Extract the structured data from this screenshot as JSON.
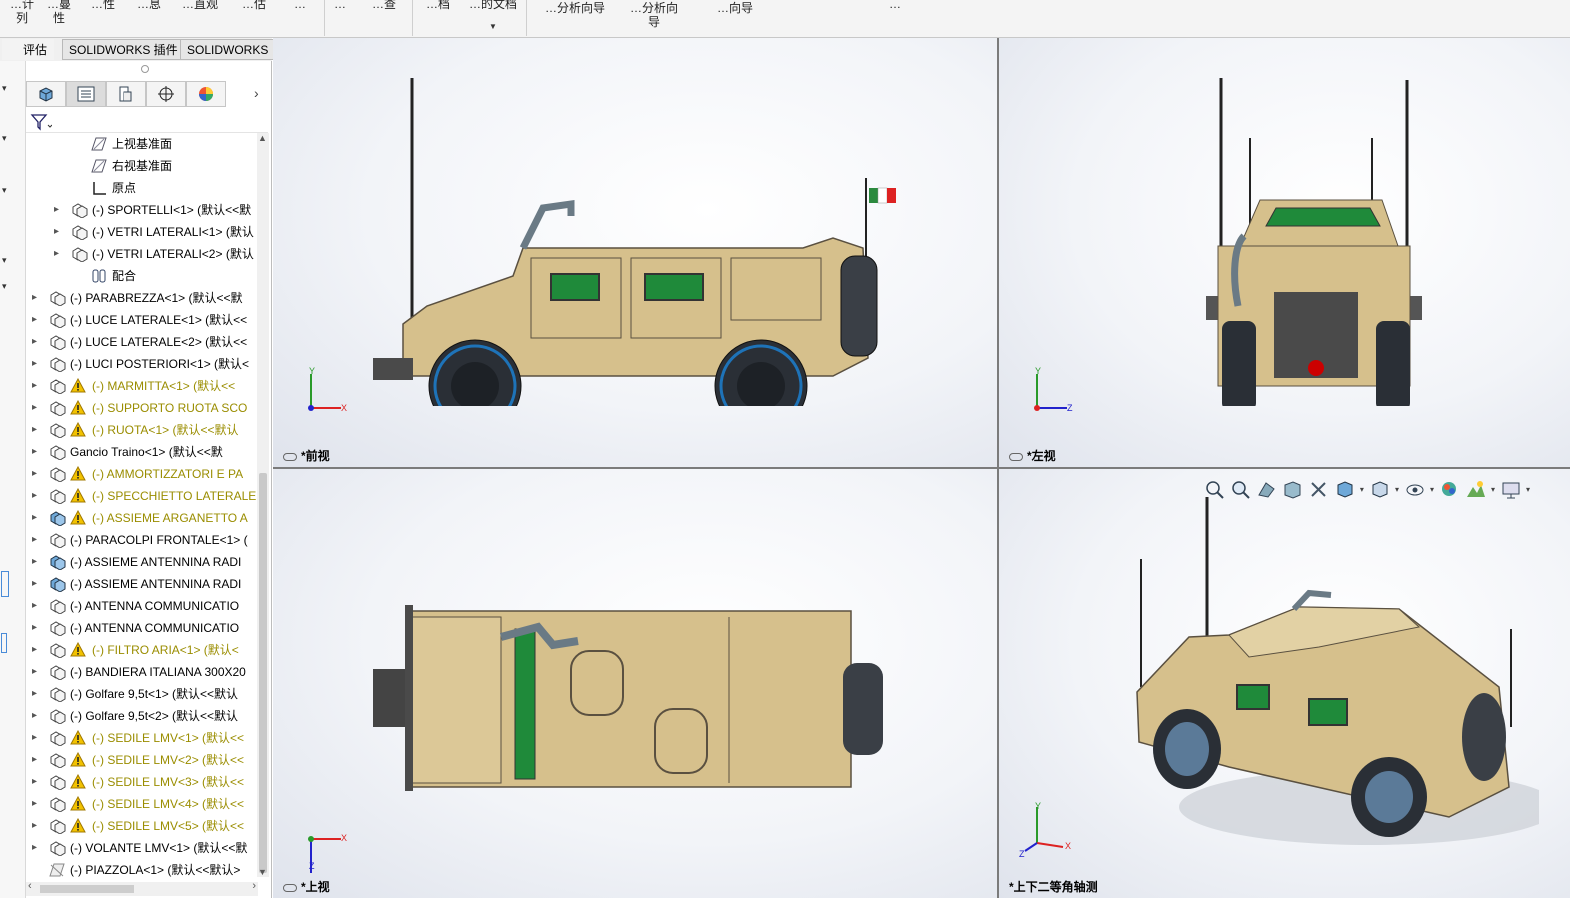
{
  "ribbon": {
    "items": [
      "…计\n列",
      "…蔓\n性",
      "…性",
      "…息",
      "…直观",
      "…估",
      "…",
      "…查",
      "…档",
      "…的文档",
      "…分析向导",
      "…分析向\n导",
      "…向导",
      "…",
      "…"
    ]
  },
  "tabs": {
    "evaluate": "评估",
    "addins": "SOLIDWORKS 插件",
    "mbd": "SOLIDWORKS MBD"
  },
  "tree": {
    "items": [
      {
        "label": "上视基准面",
        "indent": 2,
        "expandable": false,
        "icon": "plane-icon",
        "warn": false
      },
      {
        "label": "右视基准面",
        "indent": 2,
        "expandable": false,
        "icon": "plane-icon",
        "warn": false
      },
      {
        "label": "原点",
        "indent": 2,
        "expandable": false,
        "icon": "origin-icon",
        "warn": false
      },
      {
        "label": "(-) SPORTELLI<1> (默认<<默",
        "indent": 1,
        "expandable": true,
        "icon": "assembly-icon",
        "warn": false
      },
      {
        "label": "(-) VETRI LATERALI<1> (默认",
        "indent": 1,
        "expandable": true,
        "icon": "assembly-icon",
        "warn": false
      },
      {
        "label": "(-) VETRI LATERALI<2> (默认",
        "indent": 1,
        "expandable": true,
        "icon": "assembly-icon",
        "warn": false
      },
      {
        "label": "配合",
        "indent": 2,
        "expandable": false,
        "icon": "mates-icon",
        "warn": false
      },
      {
        "label": "(-) PARABREZZA<1> (默认<<默",
        "indent": 0,
        "expandable": true,
        "icon": "assembly-icon",
        "warn": false
      },
      {
        "label": "(-) LUCE LATERALE<1> (默认<<",
        "indent": 0,
        "expandable": true,
        "icon": "assembly-icon",
        "warn": false
      },
      {
        "label": "(-) LUCE LATERALE<2> (默认<<",
        "indent": 0,
        "expandable": true,
        "icon": "assembly-icon",
        "warn": false
      },
      {
        "label": "(-) LUCI POSTERIORI<1> (默认<",
        "indent": 0,
        "expandable": true,
        "icon": "assembly-icon",
        "warn": false
      },
      {
        "label": "(-) MARMITTA<1> (默认<<",
        "indent": 0,
        "expandable": true,
        "icon": "assembly-icon",
        "warn": true
      },
      {
        "label": "(-) SUPPORTO RUOTA SCO",
        "indent": 0,
        "expandable": true,
        "icon": "assembly-icon",
        "warn": true
      },
      {
        "label": "(-) RUOTA<1> (默认<<默认",
        "indent": 0,
        "expandable": true,
        "icon": "assembly-icon",
        "warn": true
      },
      {
        "label": "Gancio Traino<1> (默认<<默",
        "indent": 0,
        "expandable": true,
        "icon": "assembly-icon",
        "warn": false
      },
      {
        "label": "(-) AMMORTIZZATORI E PA",
        "indent": 0,
        "expandable": true,
        "icon": "assembly-icon",
        "warn": true
      },
      {
        "label": "(-) SPECCHIETTO LATERALE",
        "indent": 0,
        "expandable": true,
        "icon": "assembly-icon",
        "warn": true
      },
      {
        "label": "(-) ASSIEME ARGANETTO A",
        "indent": 0,
        "expandable": true,
        "icon": "assembly-blue-icon",
        "warn": true
      },
      {
        "label": "(-) PARACOLPI FRONTALE<1> (",
        "indent": 0,
        "expandable": true,
        "icon": "assembly-icon",
        "warn": false
      },
      {
        "label": "(-) ASSIEME ANTENNINA RADI",
        "indent": 0,
        "expandable": true,
        "icon": "assembly-blue-icon",
        "warn": false
      },
      {
        "label": "(-) ASSIEME ANTENNINA RADI",
        "indent": 0,
        "expandable": true,
        "icon": "assembly-blue-icon",
        "warn": false
      },
      {
        "label": "(-) ANTENNA COMMUNICATIO",
        "indent": 0,
        "expandable": true,
        "icon": "assembly-icon",
        "warn": false
      },
      {
        "label": "(-) ANTENNA COMMUNICATIO",
        "indent": 0,
        "expandable": true,
        "icon": "assembly-icon",
        "warn": false
      },
      {
        "label": "(-) FILTRO ARIA<1> (默认<",
        "indent": 0,
        "expandable": true,
        "icon": "assembly-icon",
        "warn": true
      },
      {
        "label": "(-) BANDIERA ITALIANA 300X20",
        "indent": 0,
        "expandable": true,
        "icon": "assembly-icon",
        "warn": false
      },
      {
        "label": "(-) Golfare 9,5t<1> (默认<<默认",
        "indent": 0,
        "expandable": true,
        "icon": "assembly-icon",
        "warn": false
      },
      {
        "label": "(-) Golfare 9,5t<2> (默认<<默认",
        "indent": 0,
        "expandable": true,
        "icon": "assembly-icon",
        "warn": false
      },
      {
        "label": "(-) SEDILE LMV<1> (默认<<",
        "indent": 0,
        "expandable": true,
        "icon": "assembly-icon",
        "warn": true
      },
      {
        "label": "(-) SEDILE LMV<2> (默认<<",
        "indent": 0,
        "expandable": true,
        "icon": "assembly-icon",
        "warn": true
      },
      {
        "label": "(-) SEDILE LMV<3> (默认<<",
        "indent": 0,
        "expandable": true,
        "icon": "assembly-icon",
        "warn": true
      },
      {
        "label": "(-) SEDILE LMV<4> (默认<<",
        "indent": 0,
        "expandable": true,
        "icon": "assembly-icon",
        "warn": true
      },
      {
        "label": "(-) SEDILE LMV<5> (默认<<",
        "indent": 0,
        "expandable": true,
        "icon": "assembly-icon",
        "warn": true
      },
      {
        "label": "(-) VOLANTE LMV<1> (默认<<默",
        "indent": 0,
        "expandable": true,
        "icon": "assembly-icon",
        "warn": false
      },
      {
        "label": "(-) PIAZZOLA<1> (默认<<默认>",
        "indent": 0,
        "expandable": false,
        "icon": "part-suppressed-icon",
        "warn": false
      }
    ]
  },
  "viewports": {
    "front": {
      "label": "*前视",
      "axis_h": "X",
      "axis_v": "Y"
    },
    "left": {
      "label": "*左视",
      "axis_h": "Z",
      "axis_v": "Y"
    },
    "top": {
      "label": "*上视",
      "axis_h": "X",
      "axis_v": "Z"
    },
    "iso": {
      "label": "*上下二等角轴测",
      "axis_h": "X",
      "axis_v": "Y",
      "axis_d": "Z"
    }
  },
  "colors": {
    "vehicle_tan": "#d6c08c",
    "vehicle_dark": "#5a5040",
    "glass_green": "#1f8a3a",
    "tire": "#2a2f36",
    "rim_blue": "#1e73b8",
    "warn_text": "#9a8d00"
  }
}
